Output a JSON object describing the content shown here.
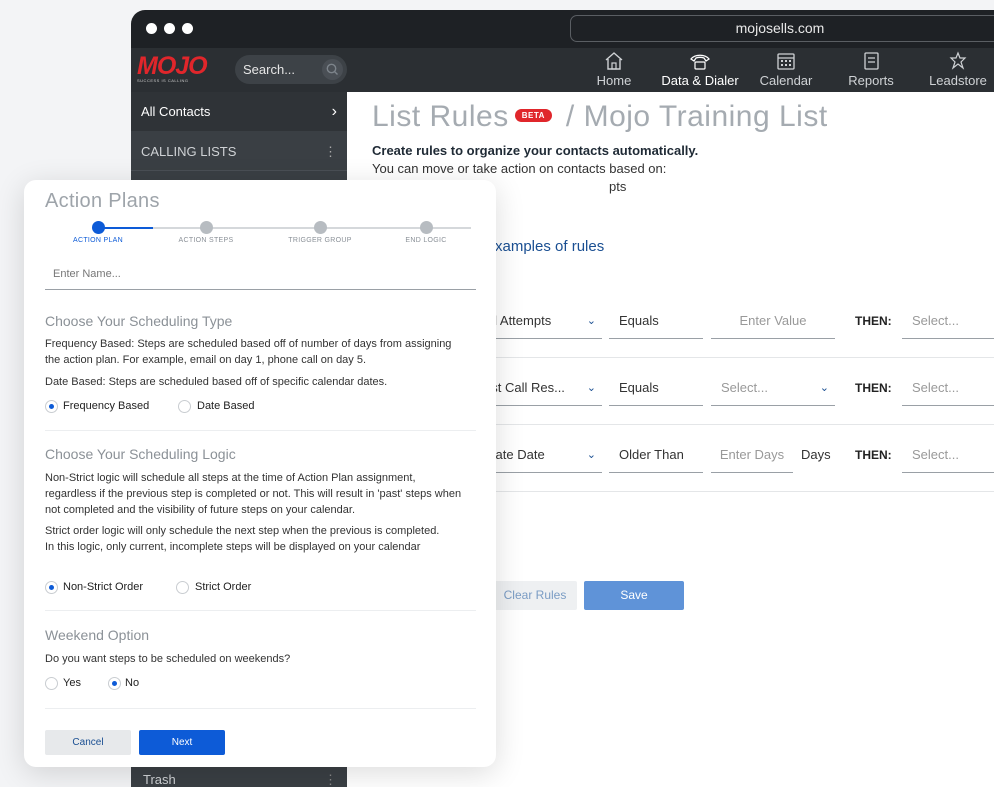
{
  "browser": {
    "url": "mojosells.com"
  },
  "appbar": {
    "logo_text": "MOJO",
    "logo_tagline": "SUCCESS IS CALLING",
    "search_placeholder": "Search...",
    "nav": [
      {
        "label": "Home",
        "icon": "home-icon"
      },
      {
        "label": "Data & Dialer",
        "icon": "phone-icon",
        "active": true
      },
      {
        "label": "Calendar",
        "icon": "calendar-icon"
      },
      {
        "label": "Reports",
        "icon": "reports-icon"
      },
      {
        "label": "Leadstore",
        "icon": "leadstore-icon"
      }
    ]
  },
  "sidebar": {
    "all_contacts": "All Contacts",
    "calling_lists": "CALLING LISTS",
    "trash": "Trash"
  },
  "main": {
    "title": "List Rules",
    "beta": "BETA",
    "list_name": "/ Mojo Training List",
    "subtitle": "Create rules to organize your contacts automatically.",
    "subtitle2": "You can move or take action on contacts based on:",
    "subtitle3_partial": "pts",
    "examples_link": "xamples of rules",
    "rules": [
      {
        "field": "all Attempts",
        "operator": "Equals",
        "value": "Enter Value",
        "then": "THEN:",
        "action": "Select..."
      },
      {
        "field": "ast Call Res...",
        "operator": "Equals",
        "value": "Select...",
        "then": "THEN:",
        "action": "Select..."
      },
      {
        "field": "reate Date",
        "operator": "Older Than",
        "value": "Enter Days",
        "unit": "Days",
        "then": "THEN:",
        "action": "Select..."
      }
    ],
    "clear_button": "Clear Rules",
    "save_button": "Save"
  },
  "modal": {
    "title": "Action Plans",
    "steps": [
      "ACTION PLAN",
      "ACTION STEPS",
      "TRIGGER GROUP",
      "END LOGIC"
    ],
    "name_placeholder": "Enter Name...",
    "scheduling_type": {
      "title": "Choose Your Scheduling Type",
      "freq_desc": "Frequency Based: Steps are scheduled based off of number of days from assigning the action plan. For example, email on day 1, phone call on day 5.",
      "date_desc": "Date Based: Steps are scheduled based off of specific calendar dates.",
      "opt1": "Frequency Based",
      "opt2": "Date Based"
    },
    "scheduling_logic": {
      "title": "Choose Your Scheduling Logic",
      "nonstrict_desc": "Non-Strict logic will schedule all steps at the time of Action Plan assignment, regardless if the previous step is completed or not. This will result in 'past' steps when not completed and the visibility of future steps on your calendar.",
      "strict_desc": "Strict order logic will only schedule the next step when the previous is completed. In this logic, only current, incomplete steps will be displayed on your calendar",
      "opt1": "Non-Strict Order",
      "opt2": "Strict Order"
    },
    "weekend": {
      "title": "Weekend Option",
      "question": "Do you want steps to be scheduled on weekends?",
      "yes": "Yes",
      "no": "No"
    },
    "cancel": "Cancel",
    "next": "Next"
  }
}
